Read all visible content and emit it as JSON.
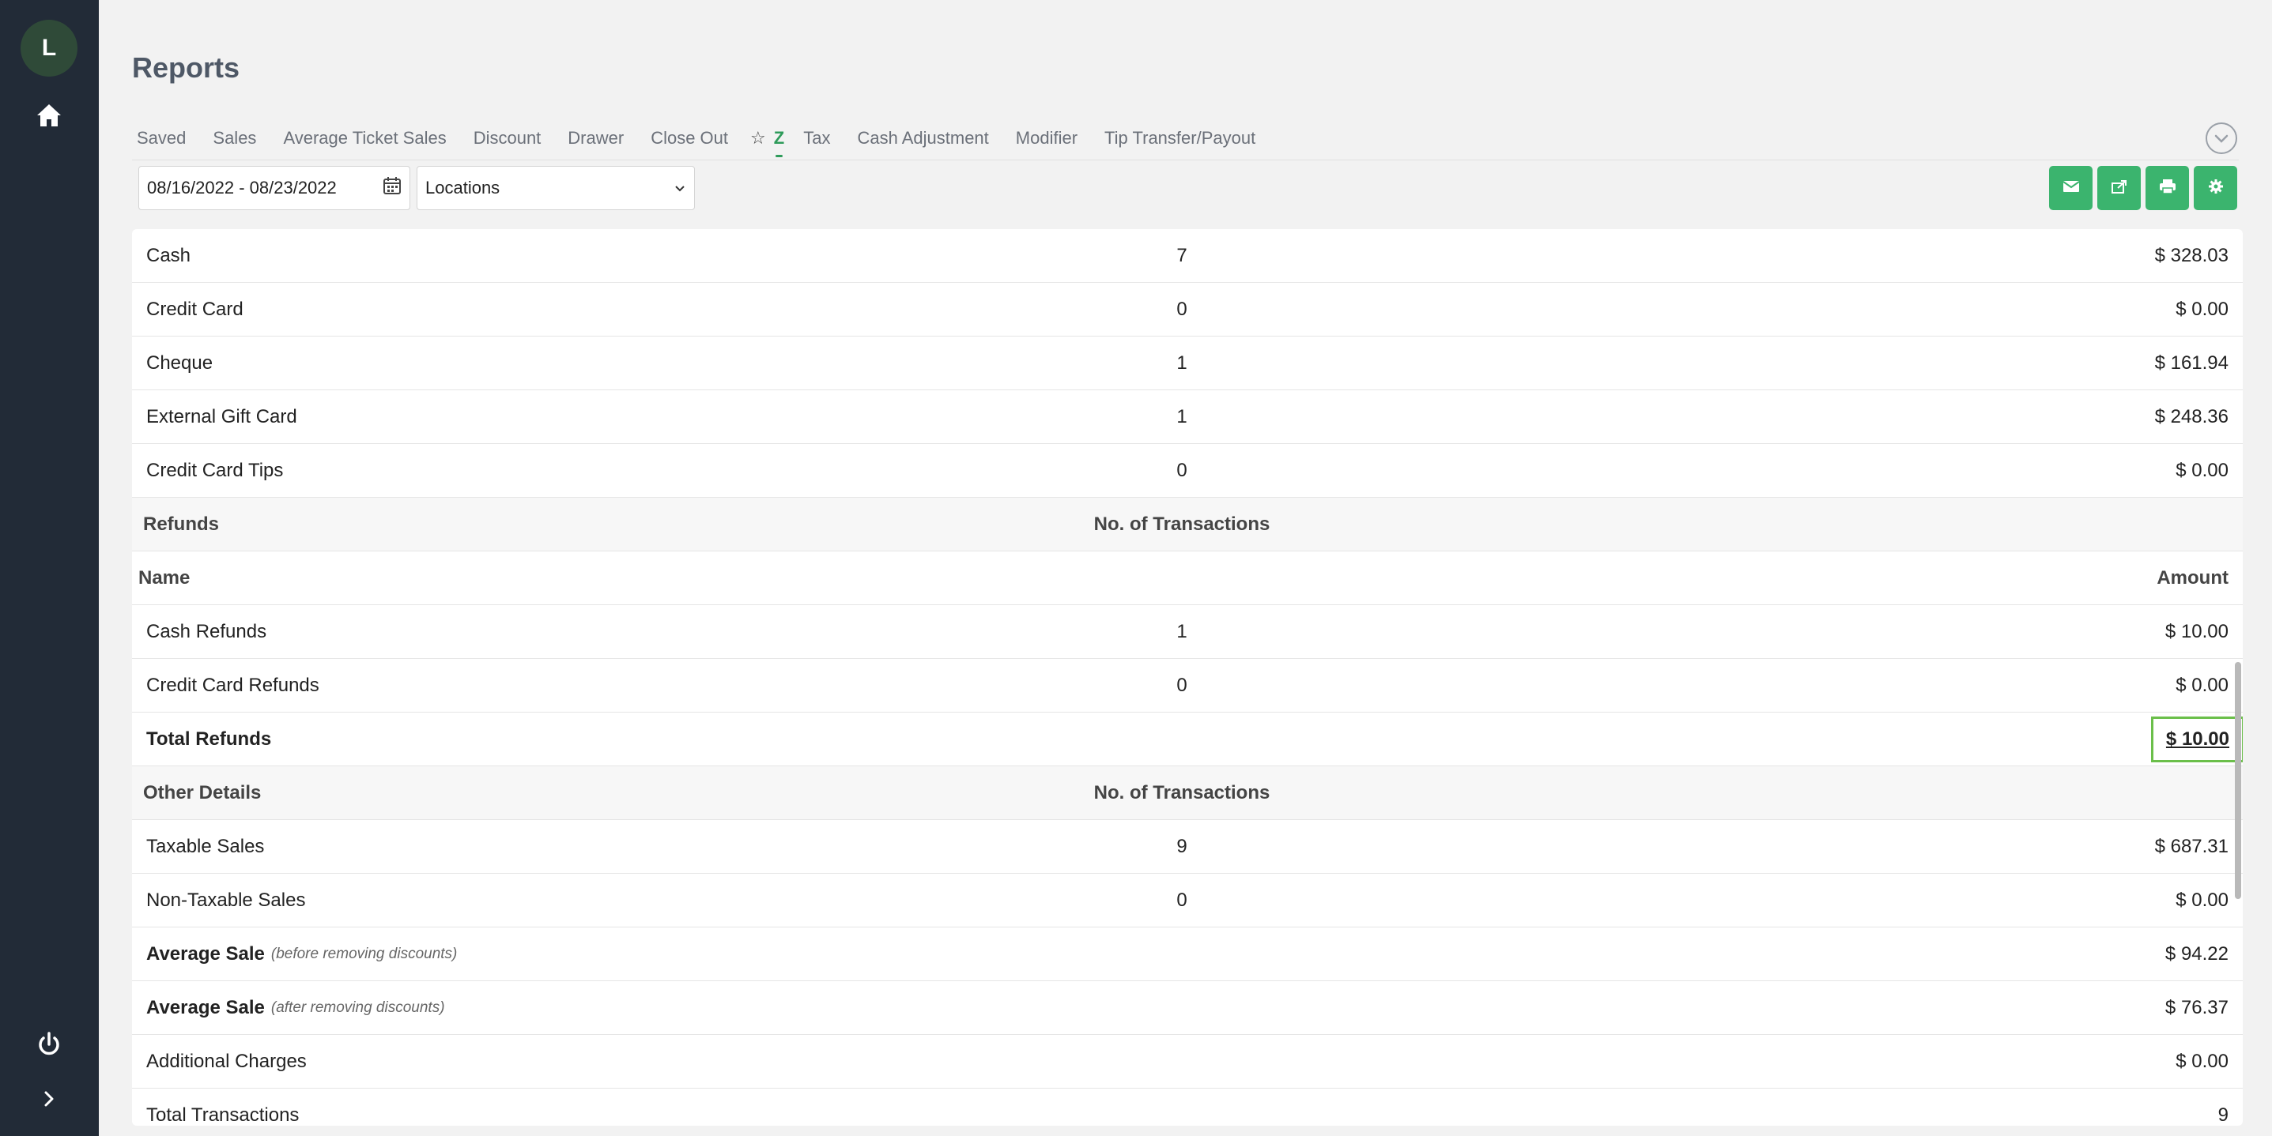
{
  "user": {
    "initial": "L"
  },
  "page": {
    "title": "Reports"
  },
  "tabs": [
    {
      "label": "Saved"
    },
    {
      "label": "Sales"
    },
    {
      "label": "Average Ticket Sales"
    },
    {
      "label": "Discount"
    },
    {
      "label": "Drawer"
    },
    {
      "label": "Close Out"
    },
    {
      "label": "Z"
    },
    {
      "label": "Tax"
    },
    {
      "label": "Cash Adjustment"
    },
    {
      "label": "Modifier"
    },
    {
      "label": "Tip Transfer/Payout"
    }
  ],
  "active_tab": "Z",
  "filters": {
    "date_range": "08/16/2022 - 08/23/2022",
    "location": "Locations"
  },
  "colors": {
    "accent": "#3bb46e",
    "sidebar": "#222b37",
    "highlight_border": "#6bbf4a"
  },
  "table": {
    "payment_rows": [
      {
        "name": "Cash",
        "count": "7",
        "amount": "$ 328.03"
      },
      {
        "name": "Credit Card",
        "count": "0",
        "amount": "$ 0.00"
      },
      {
        "name": "Cheque",
        "count": "1",
        "amount": "$ 161.94"
      },
      {
        "name": "External Gift Card",
        "count": "1",
        "amount": "$ 248.36"
      },
      {
        "name": "Credit Card Tips",
        "count": "0",
        "amount": "$ 0.00"
      }
    ],
    "refunds_header": {
      "title": "Refunds",
      "count_label": "No. of Transactions"
    },
    "refunds_subheader": {
      "name_label": "Name",
      "amount_label": "Amount"
    },
    "refund_rows": [
      {
        "name": "Cash Refunds",
        "count": "1",
        "amount": "$ 10.00"
      },
      {
        "name": "Credit Card Refunds",
        "count": "0",
        "amount": "$ 0.00"
      }
    ],
    "total_refunds": {
      "name": "Total Refunds",
      "amount": "$ 10.00"
    },
    "other_header": {
      "title": "Other Details",
      "count_label": "No. of Transactions"
    },
    "other_rows": [
      {
        "name": "Taxable Sales",
        "count": "9",
        "amount": "$ 687.31"
      },
      {
        "name": "Non-Taxable Sales",
        "count": "0",
        "amount": "$ 0.00"
      }
    ],
    "average_rows": [
      {
        "name": "Average Sale",
        "note": "(before removing discounts)",
        "amount": "$ 94.22"
      },
      {
        "name": "Average Sale",
        "note": "(after removing discounts)",
        "amount": "$ 76.37"
      }
    ],
    "additional_charges": {
      "name": "Additional Charges",
      "amount": "$ 0.00"
    },
    "total_transactions": {
      "name": "Total Transactions",
      "amount": "9"
    }
  }
}
